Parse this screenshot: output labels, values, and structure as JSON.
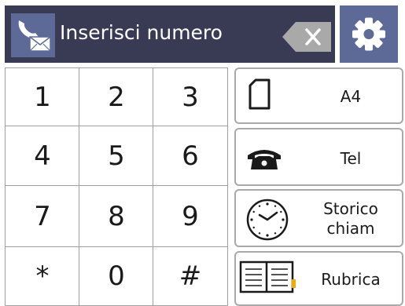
{
  "header": {
    "title": "Inserisci numero",
    "fax_icon": "fax-icon",
    "clear_icon": "backspace-icon",
    "settings_icon": "gear-icon"
  },
  "keypad": {
    "keys": [
      "1",
      "2",
      "3",
      "4",
      "5",
      "6",
      "7",
      "8",
      "9",
      "*",
      "0",
      "#"
    ]
  },
  "buttons": {
    "paper": {
      "label": "A4",
      "icon": "paper-icon"
    },
    "tel": {
      "label": "Tel",
      "icon": "telephone-icon"
    },
    "history": {
      "label_line1": "Storico",
      "label_line2": "chiam",
      "icon": "clock-icon"
    },
    "address_book": {
      "label": "Rubrica",
      "icon": "address-book-icon"
    }
  },
  "colors": {
    "header_bg": "#393a54",
    "icon_button_bg": "#5d6a97",
    "clear_button_bg": "#a9a9a9",
    "key_border": "#a0a0a0"
  }
}
